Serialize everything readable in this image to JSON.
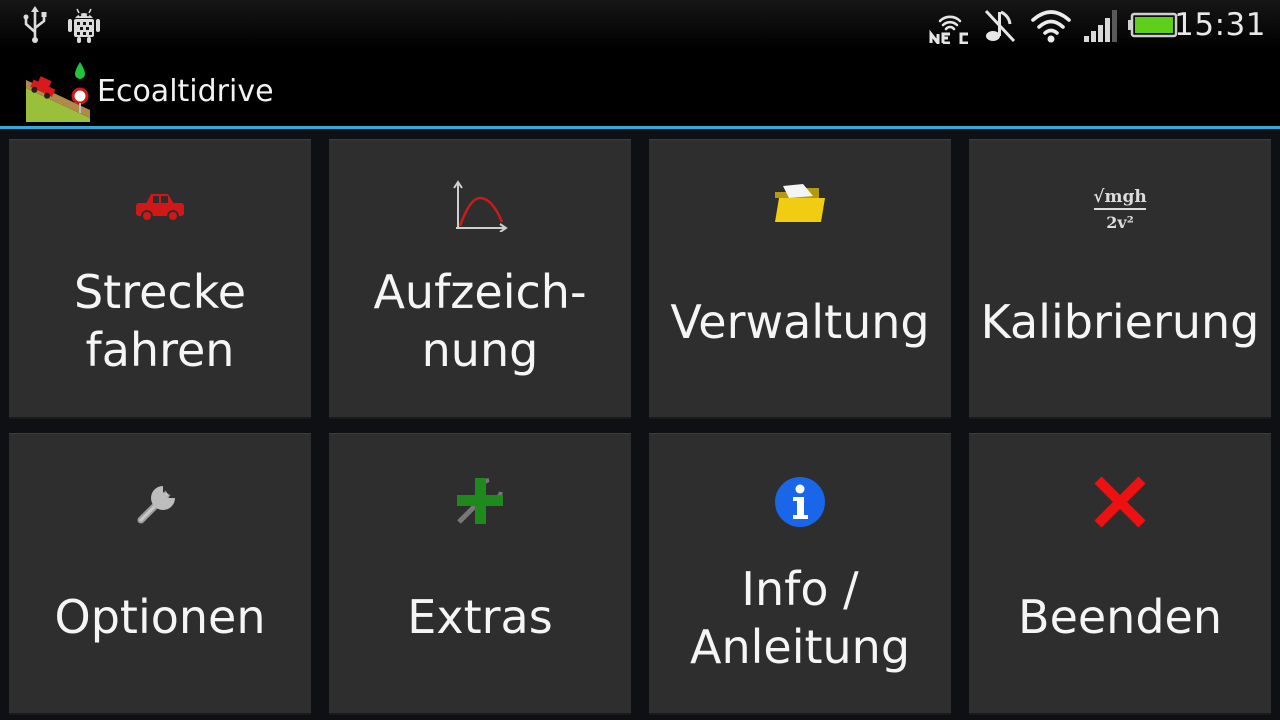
{
  "status_bar": {
    "time": "15:31",
    "icons": [
      "usb-icon",
      "android-debug-icon",
      "nfc-icon",
      "mute-icon",
      "wifi-icon",
      "signal-icon",
      "battery-icon"
    ],
    "battery_level": 1.0,
    "accent_battery": "#5fd01a"
  },
  "action_bar": {
    "title": "Ecoaltidrive",
    "divider_color": "#33a9d8"
  },
  "menu": {
    "tiles": [
      {
        "label": "Strecke\nfahren",
        "icon": "car-icon",
        "color": "#d01818"
      },
      {
        "label": "Aufzeich-\nnung",
        "icon": "chart-icon",
        "color": "#c81c1c"
      },
      {
        "label": "Verwaltung",
        "icon": "folder-icon",
        "color": "#e6c514"
      },
      {
        "label": "Kalibrierung",
        "icon": "formula-icon",
        "formula_top": "√mgh",
        "formula_bottom": "2v²"
      },
      {
        "label": "Optionen",
        "icon": "wrench-icon",
        "color": "#b0b0b0"
      },
      {
        "label": "Extras",
        "icon": "plus-icon",
        "color": "#1e8a1e"
      },
      {
        "label": "Info /\nAnleitung",
        "icon": "info-icon",
        "color": "#1a66e8"
      },
      {
        "label": "Beenden",
        "icon": "close-icon",
        "color": "#ee1111"
      }
    ]
  }
}
